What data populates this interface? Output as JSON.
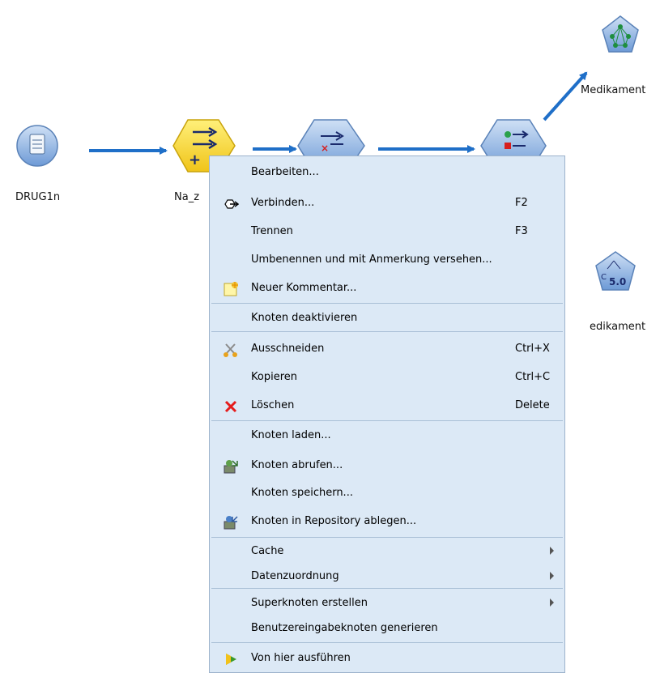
{
  "nodes": {
    "source": {
      "label": "DRUG1n",
      "icon": "database-file-icon"
    },
    "derive": {
      "label": "Na_z",
      "icon": "derive-node-icon"
    },
    "filter": {
      "icon": "filter-node-icon"
    },
    "type": {
      "icon": "type-node-icon"
    },
    "model_top": {
      "label": "Medikament",
      "icon": "neural-net-model-icon"
    },
    "model_bottom": {
      "label": "edikament",
      "icon": "c50-model-icon"
    }
  },
  "menu": {
    "items": [
      {
        "label": "Bearbeiten...",
        "shortcut": "",
        "icon": ""
      },
      {
        "label": "Verbinden...",
        "shortcut": "F2",
        "icon": "connect-icon"
      },
      {
        "label": "Trennen",
        "shortcut": "F3",
        "icon": ""
      },
      {
        "label": "Umbenennen und mit Anmerkung versehen...",
        "shortcut": "",
        "icon": ""
      },
      {
        "label": "Neuer Kommentar...",
        "shortcut": "",
        "icon": "comment-icon"
      },
      {
        "label": "Knoten deaktivieren",
        "shortcut": "",
        "icon": ""
      },
      {
        "label": "Ausschneiden",
        "shortcut": "Ctrl+X",
        "icon": "scissors-icon"
      },
      {
        "label": "Kopieren",
        "shortcut": "Ctrl+C",
        "icon": ""
      },
      {
        "label": "Löschen",
        "shortcut": "Delete",
        "icon": "delete-icon"
      },
      {
        "label": "Knoten laden...",
        "shortcut": "",
        "icon": ""
      },
      {
        "label": "Knoten abrufen...",
        "shortcut": "",
        "icon": "retrieve-icon"
      },
      {
        "label": "Knoten speichern...",
        "shortcut": "",
        "icon": ""
      },
      {
        "label": "Knoten in Repository ablegen...",
        "shortcut": "",
        "icon": "store-icon"
      },
      {
        "label": "Cache",
        "shortcut": "",
        "icon": "",
        "submenu": true
      },
      {
        "label": "Datenzuordnung",
        "shortcut": "",
        "icon": "",
        "submenu": true
      },
      {
        "label": "Superknoten erstellen",
        "shortcut": "",
        "icon": "",
        "submenu": true
      },
      {
        "label": "Benutzereingabeknoten generieren",
        "shortcut": "",
        "icon": ""
      },
      {
        "label": "Von hier ausführen",
        "shortcut": "",
        "icon": "run-icon"
      }
    ]
  },
  "colors": {
    "menu_bg": "#dce9f6",
    "arrow": "#1f6fc8",
    "node_blue": "#7fa9dd",
    "node_yellow": "#f5d21c"
  }
}
